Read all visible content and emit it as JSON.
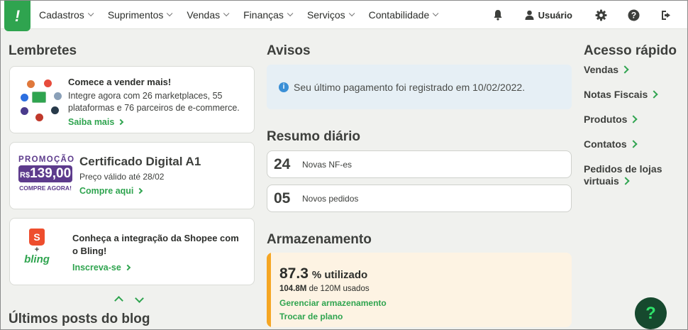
{
  "nav": {
    "items": [
      {
        "label": "Cadastros"
      },
      {
        "label": "Suprimentos"
      },
      {
        "label": "Vendas"
      },
      {
        "label": "Finanças"
      },
      {
        "label": "Serviços"
      },
      {
        "label": "Contabilidade"
      }
    ],
    "user_label": "Usuário",
    "icons": [
      "bell-icon",
      "user-icon",
      "gear-icon",
      "help-icon",
      "logout-icon"
    ]
  },
  "reminders": {
    "heading": "Lembretes",
    "marketplaces": {
      "title": "Comece a vender mais!",
      "text": "Integre agora com 26 marketplaces, 55 plataformas e 76 parceiros de e-commerce.",
      "link": "Saiba mais"
    },
    "certificate": {
      "promo_word": "PROMOÇÃO",
      "price_prefix": "R$",
      "price": "139,00",
      "buy_now": "COMPRE AGORA!",
      "title": "Certificado Digital A1",
      "validity": "Preço válido até 28/02",
      "link": "Compre aqui"
    },
    "shopee": {
      "logo_text": "bling",
      "plus": "+",
      "title": "Conheça a integração da Shopee com o Bling!",
      "link": "Inscreva-se"
    }
  },
  "blog": {
    "heading": "Últimos posts do blog"
  },
  "notices": {
    "heading": "Avisos",
    "message": "Seu último pagamento foi registrado em 10/02/2022."
  },
  "daily_summary": {
    "heading": "Resumo diário",
    "rows": [
      {
        "value": "24",
        "label": "Novas NF-es"
      },
      {
        "value": "05",
        "label": "Novos pedidos"
      }
    ]
  },
  "storage": {
    "heading": "Armazenamento",
    "percent": "87.3",
    "percent_suffix": "% utilizado",
    "used": "104.8M",
    "of_total": "de 120M usados",
    "usage_fraction": 0.873,
    "manage_link": "Gerenciar armazenamento",
    "plan_link": "Trocar de plano"
  },
  "quick_access": {
    "heading": "Acesso rápido",
    "links": [
      {
        "label": "Vendas"
      },
      {
        "label": "Notas Fiscais"
      },
      {
        "label": "Produtos"
      },
      {
        "label": "Contatos"
      },
      {
        "label": "Pedidos de lojas virtuais"
      }
    ]
  },
  "colors": {
    "brand_green": "#2fa44f",
    "promo_purple": "#5d3b8c",
    "storage_orange": "#f5a623",
    "help_dark": "#16492e"
  }
}
